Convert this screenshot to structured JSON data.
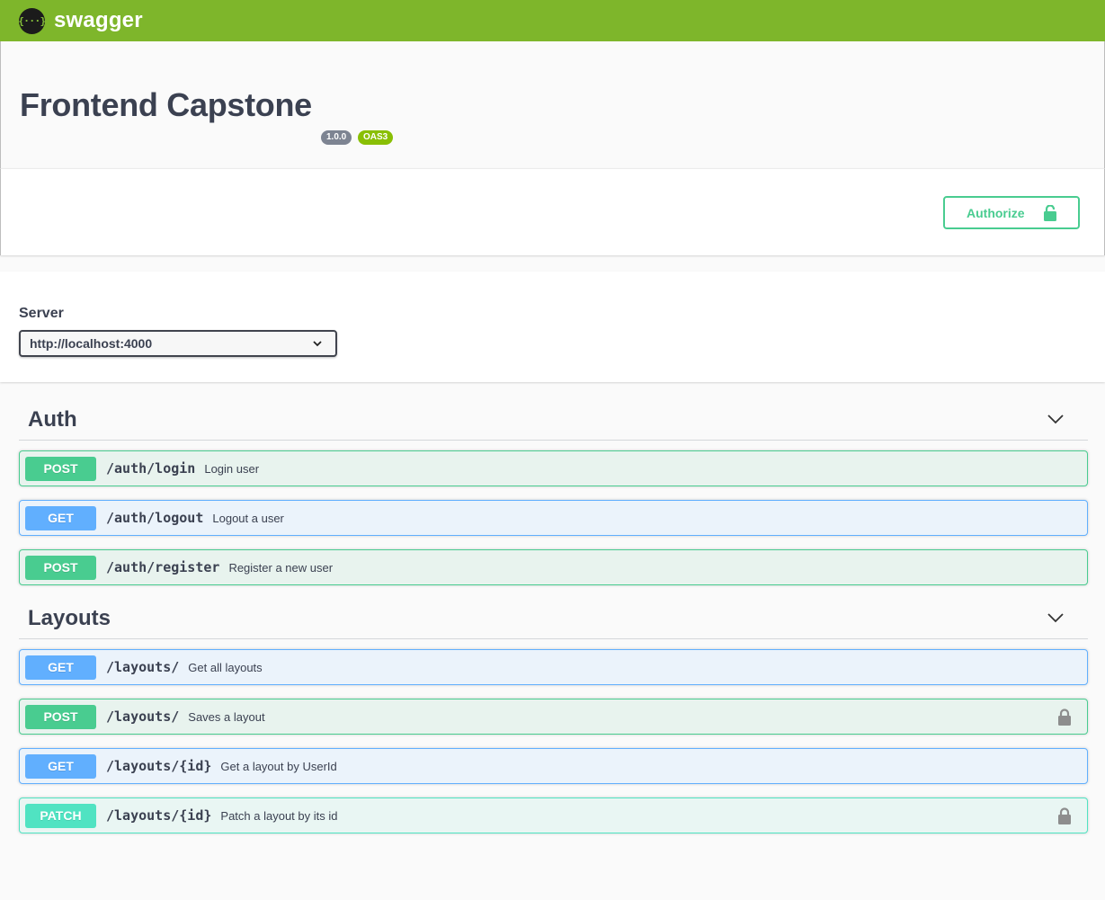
{
  "topbar": {
    "logo_glyph": "{···}",
    "brand": "swagger"
  },
  "info": {
    "title": "Frontend Capstone",
    "version_badge": "1.0.0",
    "oas_badge": "OAS3"
  },
  "authorize": {
    "label": "Authorize"
  },
  "servers": {
    "label": "Server",
    "selected": "http://localhost:4000"
  },
  "tags": [
    {
      "name": "Auth",
      "operations": [
        {
          "method": "POST",
          "path": "/auth/login",
          "summary": "Login user",
          "locked": false
        },
        {
          "method": "GET",
          "path": "/auth/logout",
          "summary": "Logout a user",
          "locked": false
        },
        {
          "method": "POST",
          "path": "/auth/register",
          "summary": "Register a new user",
          "locked": false
        }
      ]
    },
    {
      "name": "Layouts",
      "operations": [
        {
          "method": "GET",
          "path": "/layouts/",
          "summary": "Get all layouts",
          "locked": false
        },
        {
          "method": "POST",
          "path": "/layouts/",
          "summary": "Saves a layout",
          "locked": true
        },
        {
          "method": "GET",
          "path": "/layouts/{id}",
          "summary": "Get a layout by UserId",
          "locked": false
        },
        {
          "method": "PATCH",
          "path": "/layouts/{id}",
          "summary": "Patch a layout by its id",
          "locked": true
        }
      ]
    }
  ],
  "colors": {
    "topbar": "#7eb62b",
    "post": "#49cc90",
    "get": "#61affe",
    "patch": "#50e3c2",
    "text": "#3b4151"
  }
}
